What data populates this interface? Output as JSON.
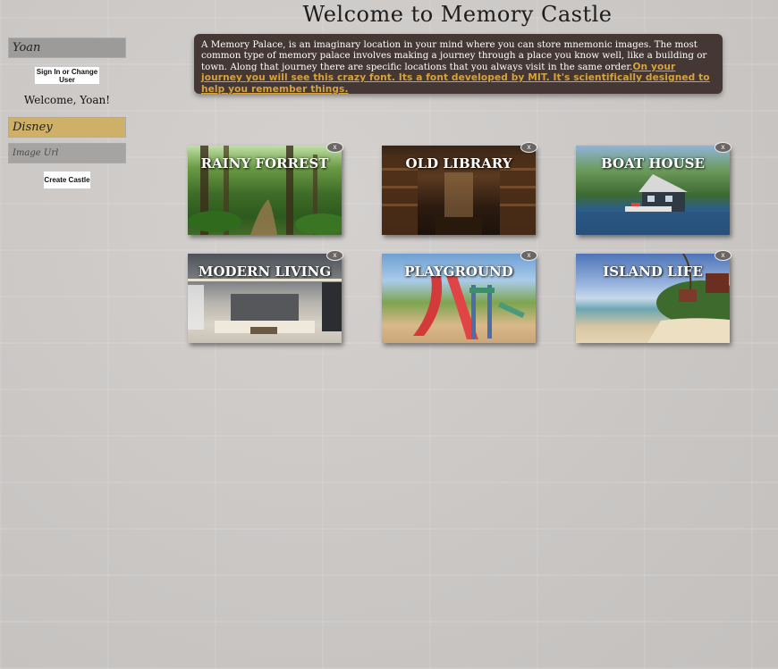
{
  "page": {
    "title": "Welcome to Memory Castle"
  },
  "sidebar": {
    "username_value": "Yoan",
    "signin_label": "Sign In or Change User",
    "welcome": "Welcome, Yoan!",
    "castle_name_value": "Disney",
    "image_url_placeholder": "Image Url",
    "create_label": "Create Castle"
  },
  "info": {
    "text": "A Memory Palace, is an imaginary location in your mind where you can store mnemonic images. The most common type of memory palace involves making a journey through a place you know well, like a building or town. Along that journey there are specific locations that you always visit in the same order.",
    "highlight": "On your journey you will see this crazy font. Its a font developed by MIT. It's scientifically designed to help you remember things."
  },
  "castles": [
    {
      "title": "RAINY FORREST",
      "close": "x",
      "image": "rainy-forest-image"
    },
    {
      "title": "OLD LIBRARY",
      "close": "x",
      "image": "old-library-image"
    },
    {
      "title": "BOAT HOUSE",
      "close": "x",
      "image": "boat-house-image"
    },
    {
      "title": "MODERN LIVING",
      "close": "x",
      "image": "modern-living-image"
    },
    {
      "title": "PLAYGROUND",
      "close": "x",
      "image": "playground-image"
    },
    {
      "title": "ISLAND LIFE",
      "close": "x",
      "image": "island-life-image"
    }
  ]
}
